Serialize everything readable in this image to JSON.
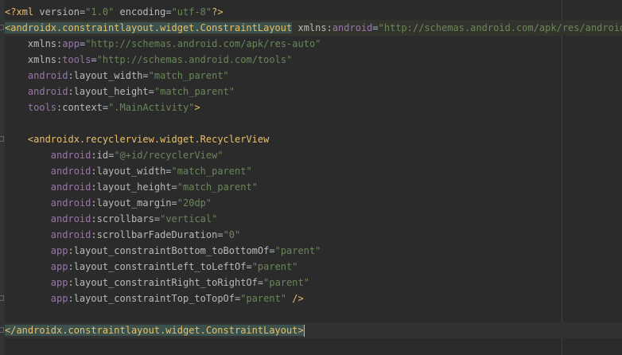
{
  "editor": {
    "lines": [
      [
        {
          "c": "t-punct",
          "t": "<?"
        },
        {
          "c": "t-tag",
          "t": "xml "
        },
        {
          "c": "t-attr",
          "t": "version"
        },
        {
          "c": "t-plain",
          "t": "="
        },
        {
          "c": "t-val",
          "t": "\"1.0\""
        },
        {
          "c": "t-plain",
          "t": " "
        },
        {
          "c": "t-attr",
          "t": "encoding"
        },
        {
          "c": "t-plain",
          "t": "="
        },
        {
          "c": "t-val",
          "t": "\"utf-8\""
        },
        {
          "c": "t-punct",
          "t": "?>"
        }
      ],
      [
        {
          "c": "t-punct tag-match",
          "t": "<androidx.constraintlayout.widget.ConstraintLayout"
        },
        {
          "c": "t-plain",
          "t": " "
        },
        {
          "c": "t-attr",
          "t": "xmlns:"
        },
        {
          "c": "t-ns",
          "t": "android"
        },
        {
          "c": "t-plain",
          "t": "="
        },
        {
          "c": "t-val",
          "t": "\"http://schemas.android.com/apk/res/android\""
        }
      ],
      [
        {
          "c": "t-plain",
          "t": "    "
        },
        {
          "c": "t-attr",
          "t": "xmlns:"
        },
        {
          "c": "t-ns",
          "t": "app"
        },
        {
          "c": "t-plain",
          "t": "="
        },
        {
          "c": "t-val",
          "t": "\"http://schemas.android.com/apk/res-auto\""
        }
      ],
      [
        {
          "c": "t-plain",
          "t": "    "
        },
        {
          "c": "t-attr",
          "t": "xmlns:"
        },
        {
          "c": "t-ns",
          "t": "tools"
        },
        {
          "c": "t-plain",
          "t": "="
        },
        {
          "c": "t-val",
          "t": "\"http://schemas.android.com/tools\""
        }
      ],
      [
        {
          "c": "t-plain",
          "t": "    "
        },
        {
          "c": "t-ns",
          "t": "android"
        },
        {
          "c": "t-attr",
          "t": ":layout_width"
        },
        {
          "c": "t-plain",
          "t": "="
        },
        {
          "c": "t-val",
          "t": "\"match_parent\""
        }
      ],
      [
        {
          "c": "t-plain",
          "t": "    "
        },
        {
          "c": "t-ns",
          "t": "android"
        },
        {
          "c": "t-attr",
          "t": ":layout_height"
        },
        {
          "c": "t-plain",
          "t": "="
        },
        {
          "c": "t-val",
          "t": "\"match_parent\""
        }
      ],
      [
        {
          "c": "t-plain",
          "t": "    "
        },
        {
          "c": "t-ns",
          "t": "tools"
        },
        {
          "c": "t-attr",
          "t": ":context"
        },
        {
          "c": "t-plain",
          "t": "="
        },
        {
          "c": "t-val",
          "t": "\".MainActivity\""
        },
        {
          "c": "t-punct",
          "t": ">"
        }
      ],
      [],
      [
        {
          "c": "t-plain",
          "t": "    "
        },
        {
          "c": "t-punct",
          "t": "<androidx.recyclerview.widget.RecyclerView"
        }
      ],
      [
        {
          "c": "t-plain",
          "t": "        "
        },
        {
          "c": "t-ns",
          "t": "android"
        },
        {
          "c": "t-attr",
          "t": ":id"
        },
        {
          "c": "t-plain",
          "t": "="
        },
        {
          "c": "t-val",
          "t": "\"@+id/recyclerView\""
        }
      ],
      [
        {
          "c": "t-plain",
          "t": "        "
        },
        {
          "c": "t-ns",
          "t": "android"
        },
        {
          "c": "t-attr",
          "t": ":layout_width"
        },
        {
          "c": "t-plain",
          "t": "="
        },
        {
          "c": "t-val",
          "t": "\"match_parent\""
        }
      ],
      [
        {
          "c": "t-plain",
          "t": "        "
        },
        {
          "c": "t-ns",
          "t": "android"
        },
        {
          "c": "t-attr",
          "t": ":layout_height"
        },
        {
          "c": "t-plain",
          "t": "="
        },
        {
          "c": "t-val",
          "t": "\"match_parent\""
        }
      ],
      [
        {
          "c": "t-plain",
          "t": "        "
        },
        {
          "c": "t-ns",
          "t": "android"
        },
        {
          "c": "t-attr",
          "t": ":layout_margin"
        },
        {
          "c": "t-plain",
          "t": "="
        },
        {
          "c": "t-val",
          "t": "\"20dp\""
        }
      ],
      [
        {
          "c": "t-plain",
          "t": "        "
        },
        {
          "c": "t-ns",
          "t": "android"
        },
        {
          "c": "t-attr",
          "t": ":scrollbars"
        },
        {
          "c": "t-plain",
          "t": "="
        },
        {
          "c": "t-val",
          "t": "\"vertical\""
        }
      ],
      [
        {
          "c": "t-plain",
          "t": "        "
        },
        {
          "c": "t-ns",
          "t": "android"
        },
        {
          "c": "t-attr",
          "t": ":scrollbarFadeDuration"
        },
        {
          "c": "t-plain",
          "t": "="
        },
        {
          "c": "t-val",
          "t": "\"0\""
        }
      ],
      [
        {
          "c": "t-plain",
          "t": "        "
        },
        {
          "c": "t-ns",
          "t": "app"
        },
        {
          "c": "t-attr",
          "t": ":layout_constraintBottom_toBottomOf"
        },
        {
          "c": "t-plain",
          "t": "="
        },
        {
          "c": "t-val",
          "t": "\"parent\""
        }
      ],
      [
        {
          "c": "t-plain",
          "t": "        "
        },
        {
          "c": "t-ns",
          "t": "app"
        },
        {
          "c": "t-attr",
          "t": ":layout_constraintLeft_toLeftOf"
        },
        {
          "c": "t-plain",
          "t": "="
        },
        {
          "c": "t-val",
          "t": "\"parent\""
        }
      ],
      [
        {
          "c": "t-plain",
          "t": "        "
        },
        {
          "c": "t-ns",
          "t": "app"
        },
        {
          "c": "t-attr",
          "t": ":layout_constraintRight_toRightOf"
        },
        {
          "c": "t-plain",
          "t": "="
        },
        {
          "c": "t-val",
          "t": "\"parent\""
        }
      ],
      [
        {
          "c": "t-plain",
          "t": "        "
        },
        {
          "c": "t-ns",
          "t": "app"
        },
        {
          "c": "t-attr",
          "t": ":layout_constraintTop_toTopOf"
        },
        {
          "c": "t-plain",
          "t": "="
        },
        {
          "c": "t-val",
          "t": "\"parent\""
        },
        {
          "c": "t-plain",
          "t": " "
        },
        {
          "c": "t-punct",
          "t": "/>"
        }
      ],
      [],
      [
        {
          "c": "t-punct tag-match",
          "t": "</androidx.constraintlayout.widget.ConstraintLayout"
        },
        {
          "c": "t-punct tag-match",
          "t": ">"
        }
      ]
    ]
  }
}
